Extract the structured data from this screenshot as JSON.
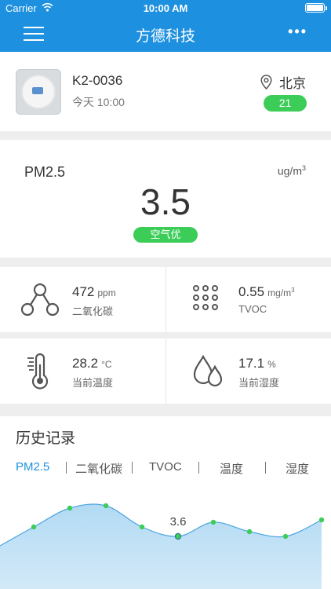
{
  "status": {
    "carrier": "Carrier",
    "time": "10:00 AM"
  },
  "nav": {
    "title": "方德科技",
    "more": "•••"
  },
  "device": {
    "name": "K2-0036",
    "time": "今天 10:00",
    "city": "北京",
    "aqi": "21"
  },
  "pm": {
    "label": "PM2.5",
    "unit": "ug/m",
    "unit_sup": "3",
    "value": "3.5",
    "quality": "空气优"
  },
  "sensors": {
    "co2": {
      "value": "472",
      "unit": "ppm",
      "label": "二氧化碳",
      "icon": "molecule-icon"
    },
    "tvoc": {
      "value": "0.55",
      "unit": "mg/m",
      "unit_sup": "3",
      "label": "TVOC",
      "icon": "dots-grid-icon"
    },
    "temp": {
      "value": "28.2",
      "unit": "°C",
      "label": "当前温度",
      "icon": "thermometer-icon"
    },
    "humidity": {
      "value": "17.1",
      "unit": "%",
      "label": "当前湿度",
      "icon": "droplets-icon"
    }
  },
  "history": {
    "title": "历史记录",
    "tabs": [
      "PM2.5",
      "二氧化碳",
      "TVOC",
      "温度",
      "湿度"
    ],
    "active_tab": "PM2.5",
    "highlight_label": "3.6",
    "colors": {
      "accent": "#1e90e0",
      "point": "#3ccd59",
      "area": "#aed8f3"
    }
  },
  "chart_data": {
    "type": "area",
    "x": [
      1,
      2,
      3,
      4,
      5,
      6,
      7,
      8,
      9
    ],
    "values": [
      4.0,
      4.8,
      4.9,
      4.0,
      3.6,
      4.2,
      3.8,
      3.6,
      4.3
    ],
    "highlight_index": 4,
    "highlight_value": "3.6",
    "grid": false,
    "legend": "none"
  }
}
